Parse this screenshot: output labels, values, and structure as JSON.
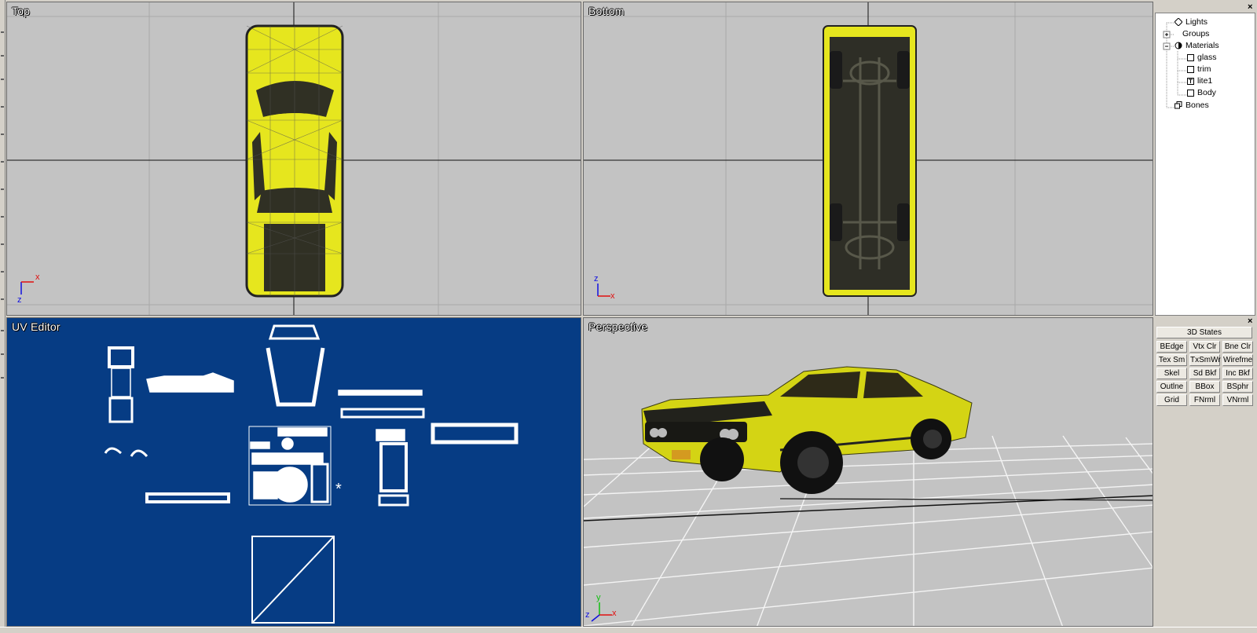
{
  "viewports": {
    "top": {
      "label": "Top"
    },
    "bottom": {
      "label": "Bottom"
    },
    "uv": {
      "label": "UV Editor"
    },
    "perspective": {
      "label": "Perspective"
    }
  },
  "axes": {
    "x": "x",
    "y": "y",
    "z": "z"
  },
  "tree": {
    "items": [
      {
        "label": "Lights",
        "icon": "light-icon"
      },
      {
        "label": "Groups",
        "icon": "group-icon"
      },
      {
        "label": "Materials",
        "icon": "material-icon"
      },
      {
        "label": "glass",
        "icon": "material-swatch-icon"
      },
      {
        "label": "trim",
        "icon": "material-swatch-icon"
      },
      {
        "label": "lite1",
        "icon": "texture-icon"
      },
      {
        "label": "Body",
        "icon": "material-swatch-icon"
      },
      {
        "label": "Bones",
        "icon": "bone-icon"
      }
    ]
  },
  "states": {
    "title": "3D States",
    "buttons": [
      "BEdge",
      "Vtx Clr",
      "Bne Clr",
      "Tex Sm",
      "TxSmWr",
      "Wirefme",
      "Skel",
      "Sd Bkf",
      "Inc Bkf",
      "Outlne",
      "BBox",
      "BSphr",
      "Grid",
      "FNrml",
      "VNrml"
    ]
  },
  "colors": {
    "viewport_bg": "#c3c3c3",
    "uv_bg": "#063c84",
    "car_yellow": "#e6e61e",
    "axis_x": "#e01010",
    "axis_y": "#10c010",
    "axis_z": "#1010e0"
  }
}
